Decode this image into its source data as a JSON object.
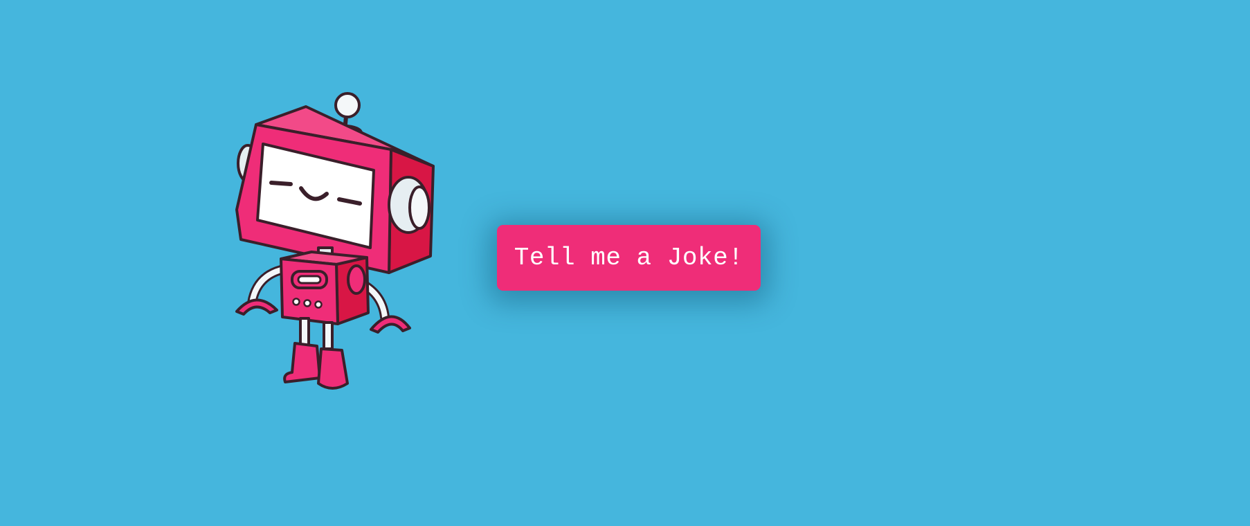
{
  "page": {
    "background_color": "#45b6dd"
  },
  "mascot": {
    "icon": "robot-icon",
    "body_color": "#ef2d78",
    "shade_color": "#d81645",
    "screen_color": "#ffffff"
  },
  "joke_button": {
    "label": "Tell me a Joke!",
    "color": "#ef2d78",
    "text_color": "#ffffff"
  }
}
